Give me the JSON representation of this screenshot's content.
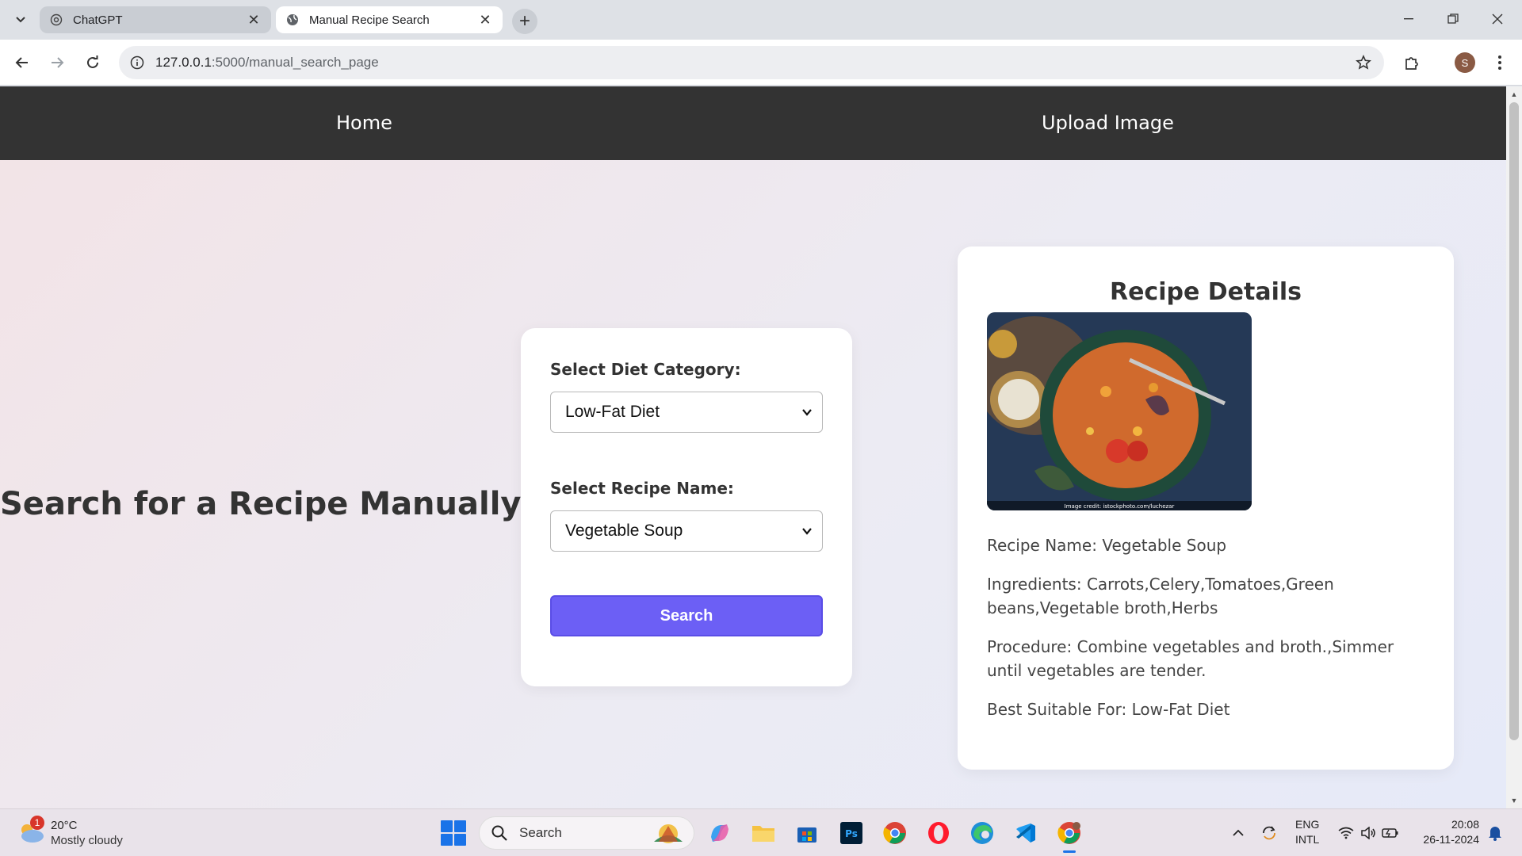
{
  "browser": {
    "tabs": [
      {
        "title": "ChatGPT",
        "active": false
      },
      {
        "title": "Manual Recipe Search",
        "active": true
      }
    ],
    "url_host": "127.0.0.1",
    "url_path": ":5000/manual_search_page",
    "profile_initial": "S"
  },
  "site_nav": {
    "home": "Home",
    "upload": "Upload Image"
  },
  "page": {
    "heading": "Search for a Recipe Manually"
  },
  "form": {
    "diet_label": "Select Diet Category:",
    "diet_value": "Low-Fat Diet",
    "recipe_label": "Select Recipe Name:",
    "recipe_value": "Vegetable Soup",
    "search_button": "Search"
  },
  "details": {
    "title": "Recipe Details",
    "image_credit": "Image credit: istockphoto.com/luchezar",
    "recipe_name": "Recipe Name: Vegetable Soup",
    "ingredients": "Ingredients: Carrots,Celery,Tomatoes,Green beans,Vegetable broth,Herbs",
    "procedure": "Procedure: Combine vegetables and broth.,Simmer until vegetables are tender.",
    "best_for": "Best Suitable For: Low-Fat Diet"
  },
  "taskbar": {
    "weather_badge": "1",
    "temperature": "20°C",
    "condition": "Mostly cloudy",
    "search_placeholder": "Search",
    "lang_line1": "ENG",
    "lang_line2": "INTL",
    "time": "20:08",
    "date": "26-11-2024"
  },
  "colors": {
    "nav_bg": "#333333",
    "button_accent": "#6c5ff5"
  }
}
